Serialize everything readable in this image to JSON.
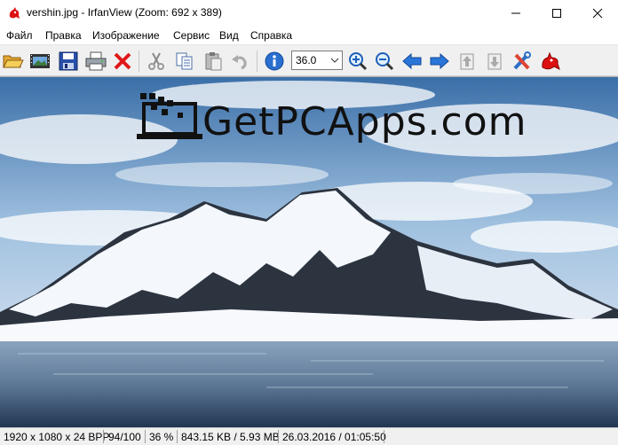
{
  "window": {
    "title": "vershin.jpg - IrfanView (Zoom: 692 x 389)",
    "minimize_icon": "minimize-icon",
    "maximize_icon": "maximize-icon",
    "close_icon": "close-icon"
  },
  "menu": {
    "items": [
      {
        "label": "Файл"
      },
      {
        "label": "Правка"
      },
      {
        "label": "Изображение"
      },
      {
        "label": "Сервис"
      },
      {
        "label": "Вид"
      },
      {
        "label": "Справка"
      }
    ]
  },
  "toolbar": {
    "buttons": [
      {
        "icon": "open-folder-icon"
      },
      {
        "icon": "slideshow-icon"
      },
      {
        "icon": "save-icon"
      },
      {
        "icon": "print-icon"
      },
      {
        "icon": "delete-icon"
      },
      {
        "icon": "cut-icon"
      },
      {
        "icon": "copy-icon"
      },
      {
        "icon": "paste-icon"
      },
      {
        "icon": "undo-icon"
      },
      {
        "icon": "info-icon"
      },
      {
        "icon": "zoom-in-icon"
      },
      {
        "icon": "zoom-out-icon"
      },
      {
        "icon": "previous-icon"
      },
      {
        "icon": "next-icon"
      },
      {
        "icon": "first-page-icon"
      },
      {
        "icon": "last-page-icon"
      },
      {
        "icon": "settings-icon"
      },
      {
        "icon": "irfanview-icon"
      }
    ],
    "zoom_value": "36.0"
  },
  "image": {
    "watermark": "GetPCApps.com",
    "colors": {
      "sky_top": "#3b6fa8",
      "sky_mid": "#9fc0df",
      "snow": "#f4f7fb",
      "rock": "#2c3440",
      "water_top": "#8aa3be",
      "water_bottom": "#1f3550"
    }
  },
  "status": {
    "dimensions": "1920 x 1080 x 24 BPP",
    "index": "94/100",
    "zoom": "36 %",
    "size": "843.15 KB / 5.93 MB",
    "datetime": "26.03.2016 / 01:05:50"
  }
}
